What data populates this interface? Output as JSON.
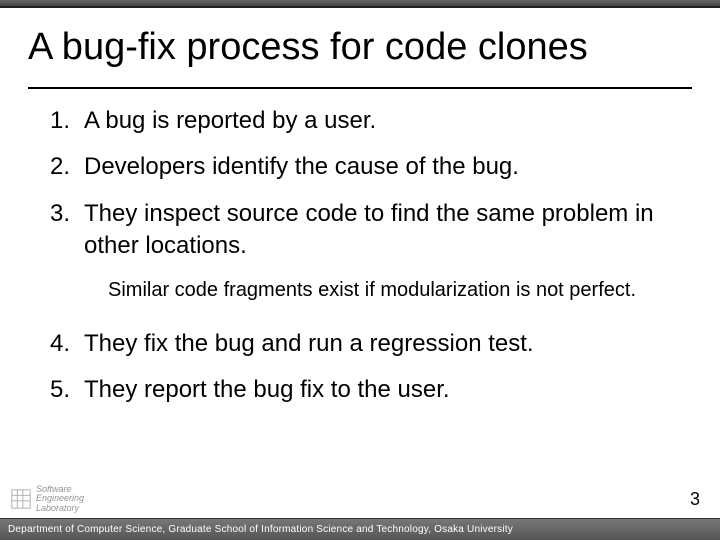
{
  "title": "A bug-fix process for code clones",
  "items": [
    "A bug is reported by a user.",
    "Developers identify the cause of the bug.",
    "They inspect source code to find the same problem in other locations.",
    "They fix the bug and run a regression test.",
    "They report the bug fix to the user."
  ],
  "note": "Similar code fragments exist if modularization is not perfect.",
  "page_number": "3",
  "footer": "Department of Computer Science, Graduate School of Information Science and Technology, Osaka University",
  "logo_text": "Software\nEngineering\nLaboratory"
}
